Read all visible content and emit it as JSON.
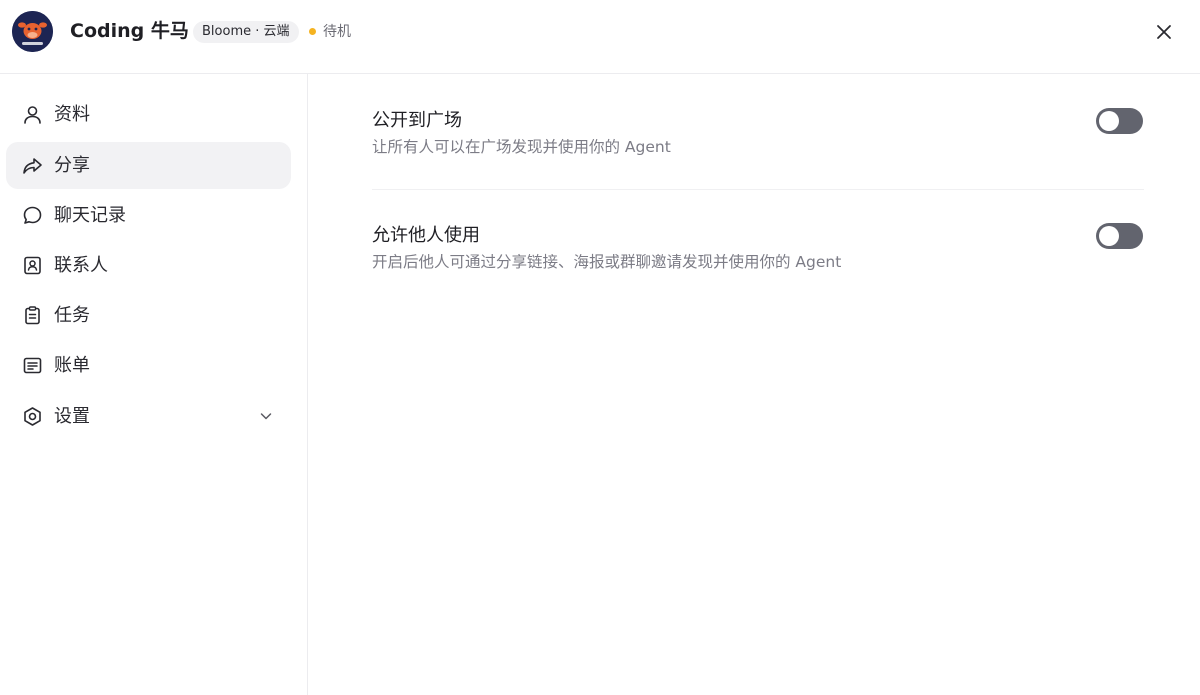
{
  "header": {
    "app_name": "Coding 牛马",
    "badge": "Bloome · 云端",
    "status": "待机",
    "status_color": "#f5b321",
    "close_icon": "close-icon"
  },
  "sidebar": {
    "items": [
      {
        "label": "资料",
        "icon": "user-icon",
        "active": false
      },
      {
        "label": "分享",
        "icon": "share-icon",
        "active": true
      },
      {
        "label": "聊天记录",
        "icon": "chat-bubble-icon",
        "active": false
      },
      {
        "label": "联系人",
        "icon": "contact-card-icon",
        "active": false
      },
      {
        "label": "任务",
        "icon": "clipboard-icon",
        "active": false
      },
      {
        "label": "账单",
        "icon": "receipt-icon",
        "active": false
      },
      {
        "label": "设置",
        "icon": "settings-hexagon-icon",
        "active": false,
        "expandable": true
      }
    ]
  },
  "main": {
    "settings": [
      {
        "title": "公开到广场",
        "description": "让所有人可以在广场发现并使用你的 Agent",
        "enabled": false
      },
      {
        "title": "允许他人使用",
        "description": "开启后他人可通过分享链接、海报或群聊邀请发现并使用你的 Agent",
        "enabled": false
      }
    ]
  },
  "colors": {
    "toggle_off": "#62646e",
    "active_nav_bg": "#f2f2f4",
    "avatar_bg": "#1d2553",
    "avatar_accent": "#e8622f"
  }
}
